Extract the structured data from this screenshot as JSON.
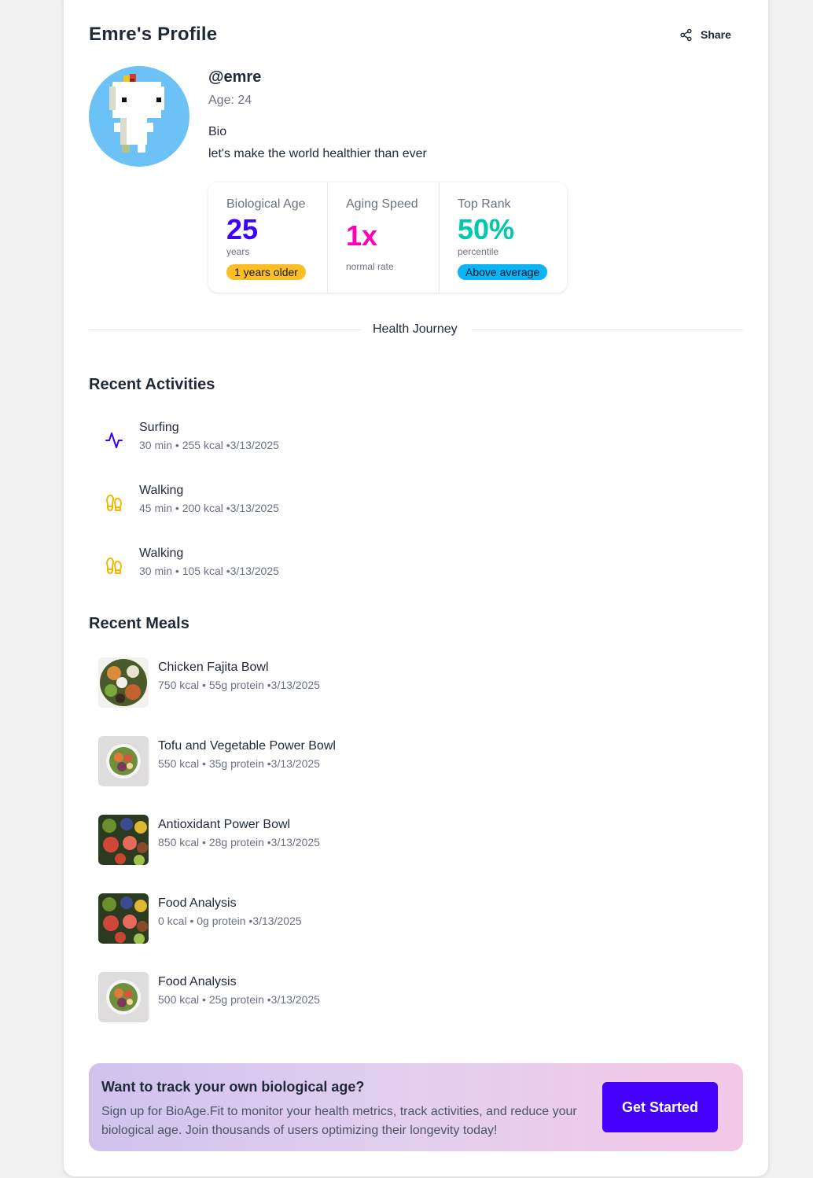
{
  "profile": {
    "title": "Emre's Profile",
    "share_label": "Share",
    "handle": "@emre",
    "age": "Age: 24",
    "bio_label": "Bio",
    "bio": "let's make the world healthier than ever"
  },
  "stats": {
    "biological_age": {
      "label": "Biological Age",
      "value": "25",
      "unit": "years",
      "badge": "1 years older",
      "color": "#3b00ff",
      "badge_color": "#fbbf24"
    },
    "aging_speed": {
      "label": "Aging Speed",
      "value": "1x",
      "unit": "normal rate",
      "color": "#ff00b8"
    },
    "top_rank": {
      "label": "Top Rank",
      "value": "50%",
      "unit": "percentile",
      "badge": "Above average",
      "color": "#00c9a7",
      "badge_color": "#0ab4f5"
    }
  },
  "journey_label": "Health Journey",
  "activities": {
    "title": "Recent Activities",
    "items": [
      {
        "name": "Surfing",
        "meta": "30 min • 255 kcal •3/13/2025",
        "icon": "activity-pulse-icon"
      },
      {
        "name": "Walking",
        "meta": "45 min • 200 kcal •3/13/2025",
        "icon": "footprints-icon"
      },
      {
        "name": "Walking",
        "meta": "30 min • 105 kcal •3/13/2025",
        "icon": "footprints-icon"
      }
    ]
  },
  "meals": {
    "title": "Recent Meals",
    "items": [
      {
        "name": "Chicken Fajita Bowl",
        "meta": "750 kcal • 55g protein •3/13/2025"
      },
      {
        "name": "Tofu and Vegetable Power Bowl",
        "meta": "550 kcal • 35g protein •3/13/2025"
      },
      {
        "name": "Antioxidant Power Bowl",
        "meta": "850 kcal • 28g protein •3/13/2025"
      },
      {
        "name": "Food Analysis",
        "meta": "0 kcal • 0g protein •3/13/2025"
      },
      {
        "name": "Food Analysis",
        "meta": "500 kcal • 25g protein •3/13/2025"
      }
    ]
  },
  "cta": {
    "title": "Want to track your own biological age?",
    "text": "Sign up for BioAge.Fit to monitor your health metrics, track activities, and reduce your biological age. Join thousands of users optimizing their longevity today!",
    "button": "Get Started",
    "button_color": "#4300ff"
  }
}
